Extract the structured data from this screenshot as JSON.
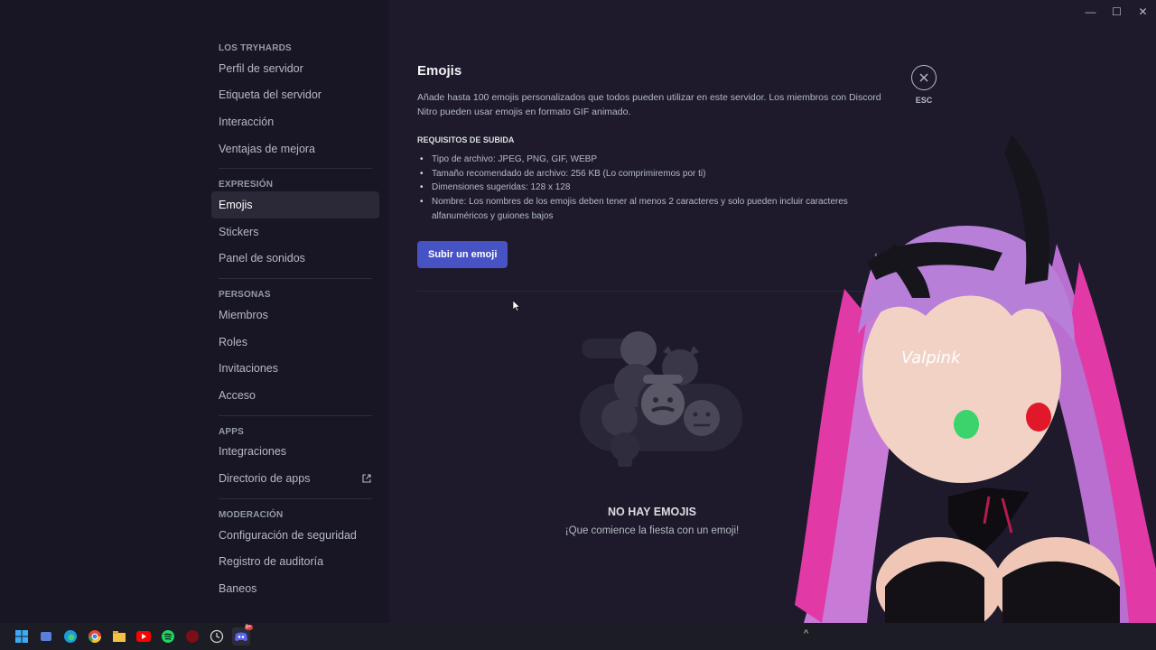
{
  "window": {
    "minimize": "—",
    "maximize": "☐",
    "close": "✕"
  },
  "sidebar": {
    "sections": [
      {
        "header": "LOS TRYHARDS",
        "items": [
          "Perfil de servidor",
          "Etiqueta del servidor",
          "Interacción",
          "Ventajas de mejora"
        ]
      },
      {
        "header": "EXPRESIÓN",
        "items": [
          "Emojis",
          "Stickers",
          "Panel de sonidos"
        ]
      },
      {
        "header": "PERSONAS",
        "items": [
          "Miembros",
          "Roles",
          "Invitaciones",
          "Acceso"
        ]
      },
      {
        "header": "APPS",
        "items": [
          "Integraciones",
          "Directorio de apps"
        ]
      },
      {
        "header": "MODERACIÓN",
        "items": [
          "Configuración de seguridad",
          "Registro de auditoría",
          "Baneos"
        ]
      }
    ],
    "active_item": "Emojis"
  },
  "main": {
    "title": "Emojis",
    "description": "Añade hasta 100 emojis personalizados que todos pueden utilizar en este servidor. Los miembros con Discord Nitro pueden usar emojis en formato GIF animado.",
    "requirements_title": "REQUISITOS DE SUBIDA",
    "requirements": [
      "Tipo de archivo: JPEG, PNG, GIF, WEBP",
      "Tamaño recomendado de archivo: 256 KB (Lo comprimiremos por ti)",
      "Dimensiones sugeridas: 128 x 128",
      "Nombre: Los nombres de los emojis deben tener al menos 2 caracteres y solo pueden incluir caracteres alfanuméricos y guiones bajos"
    ],
    "upload_button": "Subir un emoji",
    "empty_title": "NO HAY EMOJIS",
    "empty_subtitle": "¡Que comience la fiesta con un emoji!"
  },
  "esc": {
    "label": "ESC"
  },
  "overlay": {
    "watermark": "Valpink"
  },
  "taskbar": {
    "icons": [
      "windows-start-icon",
      "app-icon",
      "edge-icon",
      "chrome-icon",
      "file-explorer-icon",
      "youtube-icon",
      "spotify-icon",
      "app-red-icon",
      "clock-icon",
      "discord-icon"
    ],
    "discord_badge": "9+"
  },
  "colors": {
    "accent": "#4752c4",
    "bg": "#1e1a2c",
    "sidebar": "#181524"
  }
}
